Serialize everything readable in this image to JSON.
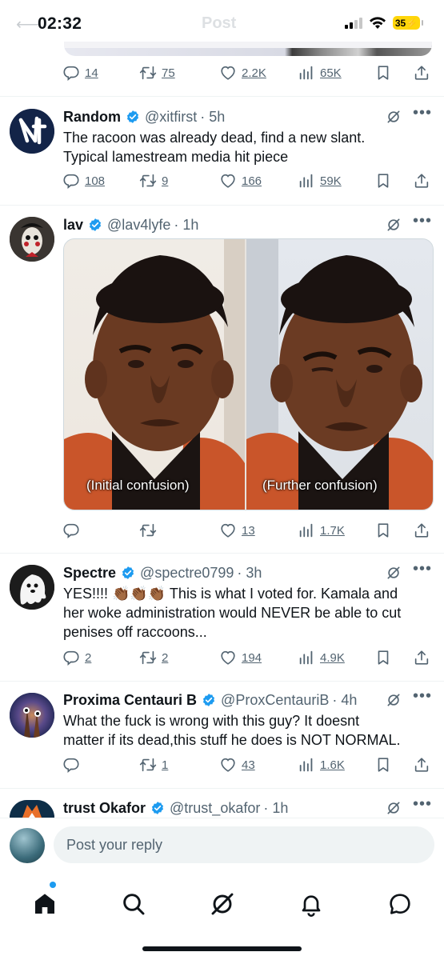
{
  "status": {
    "time": "02:32",
    "battery": "35",
    "ghost_title": "Post"
  },
  "top_actions": {
    "replies": "14",
    "reposts": "75",
    "likes": "2.2K",
    "views": "65K"
  },
  "tweets": [
    {
      "name": "Random",
      "handle": "@xitfirst",
      "time": "· 5h",
      "lines": [
        "The racoon was already dead, find a new slant.",
        "Typical lamestream media hit piece"
      ],
      "replies": "108",
      "reposts": "9",
      "likes": "166",
      "views": "59K"
    },
    {
      "name": "lav",
      "handle": "@lav4lyfe",
      "time": "· 1h",
      "lines": [],
      "meme": {
        "left_caption": "(Initial confusion)",
        "right_caption": "(Further confusion)"
      },
      "replies": "",
      "reposts": "",
      "likes": "13",
      "views": "1.7K"
    },
    {
      "name": "Spectre",
      "handle": "@spectre0799",
      "time": "· 3h",
      "lines": [
        "YES!!!! 👏🏾👏🏾👏🏾 This is what I voted for. Kamala and",
        "her woke administration would NEVER be able to cut",
        "penises off raccoons..."
      ],
      "replies": "2",
      "reposts": "2",
      "likes": "194",
      "views": "4.9K"
    },
    {
      "name": "Proxima Centauri B",
      "handle": "@ProxCentauriB",
      "time": "· 4h",
      "lines": [
        "What the fuck is wrong with this guy? It doesnt",
        "matter if its dead,this stuff he does is NOT NORMAL."
      ],
      "replies": "",
      "reposts": "1",
      "likes": "43",
      "views": "1.6K"
    },
    {
      "name": "trust Okafor",
      "handle": "@trust_okafor",
      "time": "· 1h",
      "lines": []
    }
  ],
  "reply": {
    "placeholder": "Post your reply"
  },
  "nav": [
    "home-icon",
    "search-icon",
    "grok-icon",
    "notifications-icon",
    "messages-icon"
  ],
  "colors": {
    "verified": "#1d9bf0",
    "muted": "#536471",
    "battery": "#ffd60a"
  }
}
